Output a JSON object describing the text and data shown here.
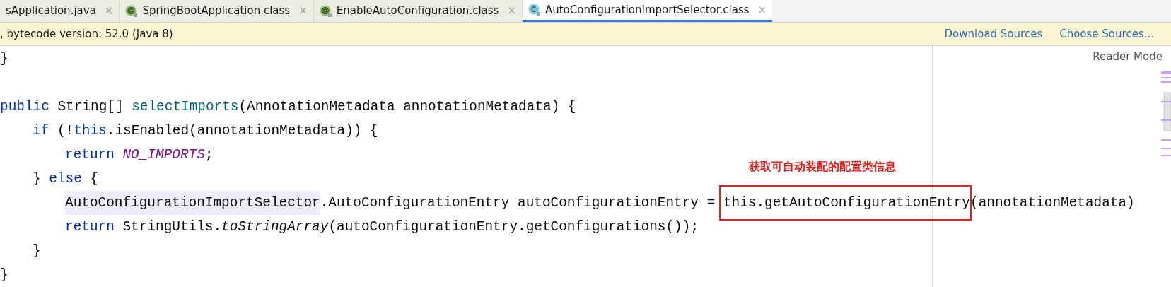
{
  "tabs": [
    {
      "label": "sApplication.java",
      "kind": "plain",
      "selected": false
    },
    {
      "label": "SpringBootApplication.class",
      "kind": "annotation",
      "selected": false
    },
    {
      "label": "EnableAutoConfiguration.class",
      "kind": "annotation",
      "selected": false
    },
    {
      "label": "AutoConfigurationImportSelector.class",
      "kind": "class",
      "selected": true
    }
  ],
  "tab_close": "×",
  "banner": {
    "message": ", bytecode version: 52.0 (Java 8)",
    "links": [
      "Download Sources",
      "Choose Sources..."
    ]
  },
  "reader_mode": "Reader Mode",
  "code_lines": [
    {
      "tokens": [
        {
          "kind": "plain",
          "text": "}"
        }
      ]
    },
    {
      "kind": "blank"
    },
    {
      "tokens": [
        {
          "kind": "keyword",
          "text": "public"
        },
        {
          "kind": "plain",
          "text": " String[] "
        },
        {
          "kind": "method",
          "text": "selectImports"
        },
        {
          "kind": "plain",
          "text": "(AnnotationMetadata annotationMetadata) {"
        }
      ],
      "children": [
        {
          "tokens": [
            {
              "kind": "keyword",
              "text": "if"
            },
            {
              "kind": "plain",
              "text": " (!"
            },
            {
              "kind": "keyword",
              "text": "this"
            },
            {
              "kind": "plain",
              "text": ".isEnabled(annotationMetadata)) {"
            }
          ],
          "children": [
            {
              "tokens": [
                {
                  "kind": "keyword",
                  "text": "return "
                },
                {
                  "kind": "constant",
                  "text": "NO_IMPORTS"
                },
                {
                  "kind": "plain",
                  "text": ";"
                }
              ]
            }
          ]
        },
        {
          "tokens": [
            {
              "kind": "plain",
              "text": "} "
            },
            {
              "kind": "keyword",
              "text": "else"
            },
            {
              "kind": "plain",
              "text": " {"
            }
          ],
          "children": [
            {
              "tokens": [
                {
                  "kind": "highlight",
                  "text": "AutoConfigurationImportSelector"
                },
                {
                  "kind": "plain",
                  "text": ".AutoConfigurationEntry autoConfigurationEntry = "
                },
                {
                  "kind": "boxed",
                  "text": "this.getAutoConfigurationEntry",
                  "note": "获取可自动装配的配置类信息"
                },
                {
                  "kind": "plain",
                  "text": "(annotationMetadata)"
                }
              ]
            },
            {
              "tokens": [
                {
                  "kind": "keyword",
                  "text": "return"
                },
                {
                  "kind": "plain",
                  "text": " StringUtils."
                },
                {
                  "kind": "static",
                  "text": "toStringArray"
                },
                {
                  "kind": "plain",
                  "text": "(autoConfigurationEntry.getConfigurations());"
                }
              ]
            }
          ]
        },
        {
          "tokens": [
            {
              "kind": "plain",
              "text": "}"
            }
          ]
        }
      ]
    },
    {
      "tokens": [
        {
          "kind": "plain",
          "text": "}"
        }
      ]
    }
  ]
}
